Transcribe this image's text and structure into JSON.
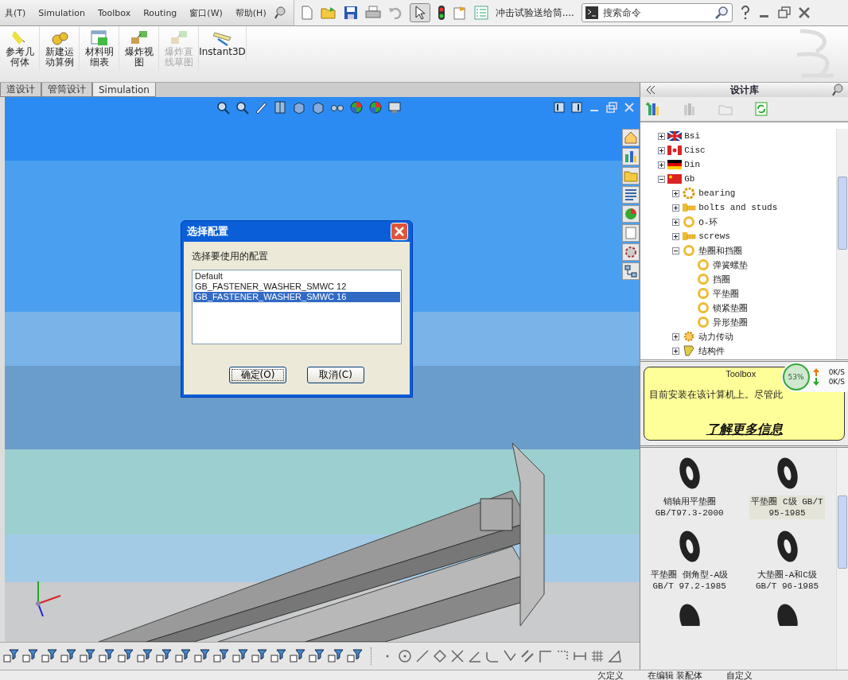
{
  "menu": [
    "具(T)",
    "Simulation",
    "Toolbox",
    "Routing",
    "窗口(W)",
    "帮助(H)"
  ],
  "document_title": "冲击试验送给筒....",
  "search": {
    "placeholder": "搜索命令"
  },
  "ribbon": [
    {
      "label": "参考几何体",
      "disabled": false,
      "kind": "geometry"
    },
    {
      "label": "新建运动算例",
      "disabled": false,
      "kind": "motion"
    },
    {
      "label": "材料明细表",
      "disabled": false,
      "kind": "table"
    },
    {
      "label": "爆炸视图",
      "disabled": false,
      "kind": "explode"
    },
    {
      "label": "爆炸直线草图",
      "disabled": true,
      "kind": "explode"
    },
    {
      "label": "Instant3D",
      "disabled": false,
      "kind": "ruler"
    }
  ],
  "tabs": [
    {
      "label": "道设计",
      "selected": false
    },
    {
      "label": "管筒设计",
      "selected": false
    },
    {
      "label": "Simulation",
      "selected": true
    }
  ],
  "dialog": {
    "title": "选择配置",
    "prompt": "选择要使用的配置",
    "options": [
      {
        "label": "Default",
        "selected": false
      },
      {
        "label": "GB_FASTENER_WASHER_SMWC 12",
        "selected": false
      },
      {
        "label": "GB_FASTENER_WASHER_SMWC 16",
        "selected": true
      }
    ],
    "buttons": [
      {
        "label": "确定(O)",
        "default": true
      },
      {
        "label": "取消(C)",
        "default": false
      }
    ]
  },
  "library": {
    "title": "设计库",
    "tree": [
      {
        "label": "Bsi",
        "kind": "uk",
        "expanded": false
      },
      {
        "label": "Cisc",
        "kind": "ca",
        "expanded": false
      },
      {
        "label": "Din",
        "kind": "de",
        "expanded": false
      },
      {
        "label": "Gb",
        "kind": "cn",
        "expanded": true,
        "children": [
          {
            "label": "bearing",
            "kind": "bearing",
            "expanded": false
          },
          {
            "label": "bolts and studs",
            "kind": "bolt",
            "expanded": false
          },
          {
            "label": "O-环",
            "kind": "ring",
            "expanded": false
          },
          {
            "label": "screws",
            "kind": "bolt",
            "expanded": false
          },
          {
            "label": "垫圈和挡圈",
            "kind": "ring",
            "expanded": true,
            "children": [
              {
                "label": "弹簧螺垫",
                "kind": "ring"
              },
              {
                "label": "挡圈",
                "kind": "ring"
              },
              {
                "label": "平垫圈",
                "kind": "ring"
              },
              {
                "label": "锁紧垫圈",
                "kind": "ring"
              },
              {
                "label": "异形垫圈",
                "kind": "ring"
              }
            ]
          },
          {
            "label": "动力传动",
            "kind": "gear",
            "expanded": false
          },
          {
            "label": "结构件",
            "kind": "beam",
            "expanded": false
          }
        ]
      }
    ],
    "notice": {
      "title": "Toolbox",
      "text": "目前安装在该计算机上。尽管此",
      "link": "了解更多信息"
    },
    "parts": [
      {
        "name": "销轴用平垫圈",
        "code": "GB/T97.3-2000",
        "selected": false
      },
      {
        "name": "平垫圈 C级 GB/T",
        "code": "95-1985",
        "selected": true
      },
      {
        "name": "平垫圈 倒角型-A级",
        "code": "GB/T 97.2-1985",
        "selected": false
      },
      {
        "name": "大垫圈-A和C级",
        "code": "GB/T 96-1985",
        "selected": false
      }
    ]
  },
  "net_widget": {
    "percent": "53%",
    "up": "0K/S",
    "down": "0K/S"
  },
  "status_bar": [
    "欠定义",
    "在编辑 装配体",
    "自定义"
  ]
}
